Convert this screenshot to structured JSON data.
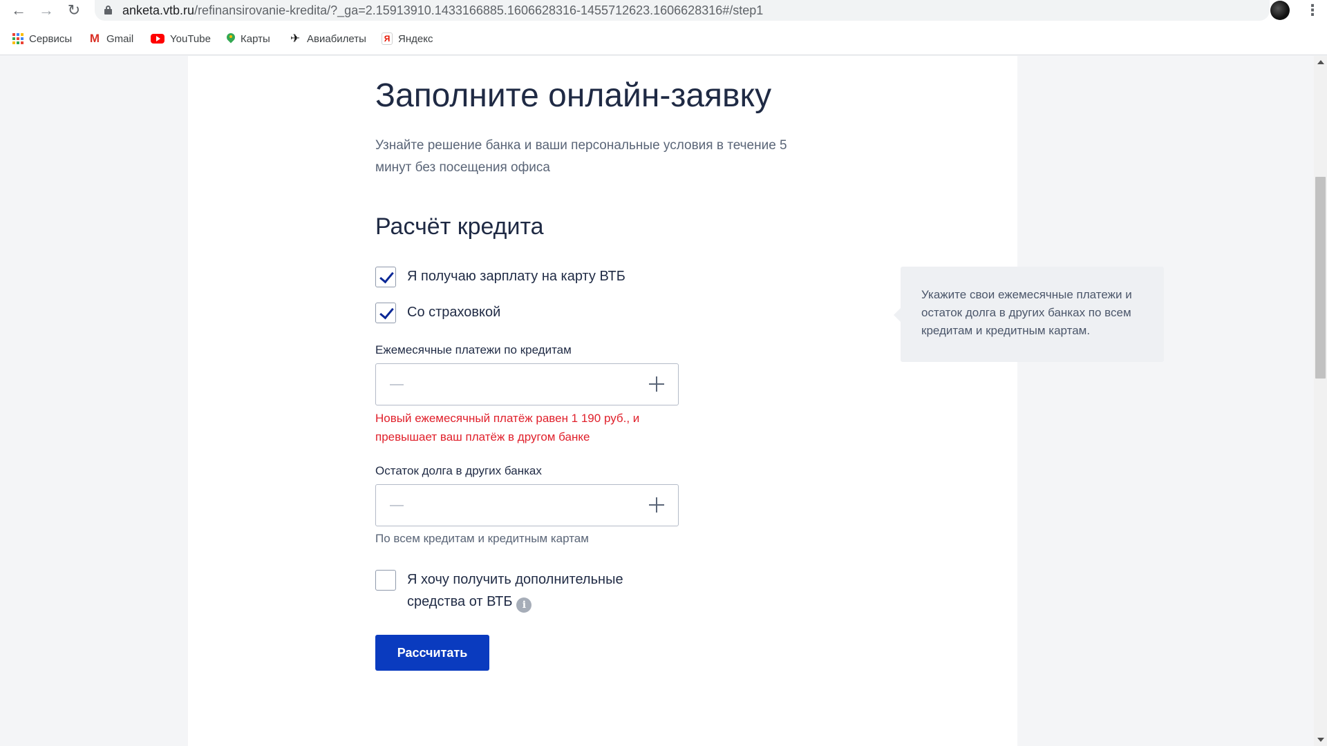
{
  "browser": {
    "url_host": "anketa.vtb.ru",
    "url_path": "/refinansirovanie-kredita/?_ga=2.15913910.1433166885.1606628316-1455712623.1606628316#/step1",
    "bookmarks": [
      {
        "label": "Сервисы",
        "icon": "apps-icon"
      },
      {
        "label": "Gmail",
        "icon": "gmail-icon"
      },
      {
        "label": "YouTube",
        "icon": "youtube-icon"
      },
      {
        "label": "Карты",
        "icon": "maps-icon"
      },
      {
        "label": "Авиабилеты",
        "icon": "plane-icon"
      },
      {
        "label": "Яндекс",
        "icon": "yandex-icon"
      }
    ]
  },
  "form": {
    "title": "Заполните онлайн-заявку",
    "subtitle": "Узнайте решение банка и ваши персональные условия в течение 5 минут без посещения офиса",
    "section_title": "Расчёт кредита",
    "salary_checkbox": {
      "label": "Я получаю зарплату на карту ВТБ",
      "checked": true
    },
    "insurance_checkbox": {
      "label": "Со страховкой",
      "checked": true
    },
    "monthly_payments": {
      "label": "Ежемесячные платежи по кредитам",
      "value": "",
      "error": "Новый ежемесячный платёж равен 1 190 руб., и превышает ваш платёж в другом банке"
    },
    "remaining_debt": {
      "label": "Остаток долга в других банках",
      "value": "",
      "hint": "По всем кредитам и кредитным картам"
    },
    "extra_funds_checkbox": {
      "label": "Я хочу получить дополнительные средства от ВТБ",
      "checked": false
    },
    "submit_label": "Рассчитать",
    "tooltip": "Укажите свои ежемесячные платежи и остаток долга в других банках по всем кредитам и кредитным картам.",
    "colors": {
      "accent": "#0a3bbf",
      "error": "#e0202b",
      "check": "#0a2896"
    }
  }
}
